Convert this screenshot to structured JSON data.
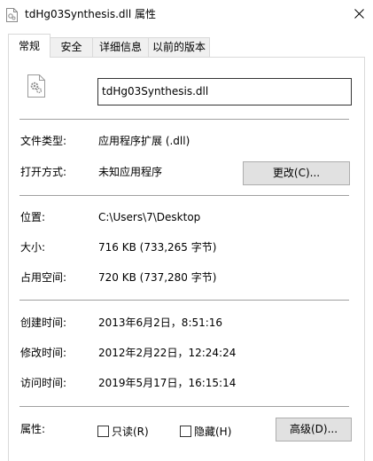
{
  "window": {
    "title": "tdHg03Synthesis.dll 属性"
  },
  "tabs": [
    {
      "label": "常规",
      "active": true
    },
    {
      "label": "安全",
      "active": false
    },
    {
      "label": "详细信息",
      "active": false
    },
    {
      "label": "以前的版本",
      "active": false
    }
  ],
  "general": {
    "file_name": "tdHg03Synthesis.dll",
    "type_label": "文件类型:",
    "type_value": "应用程序扩展 (.dll)",
    "opens_with_label": "打开方式:",
    "opens_with_value": "未知应用程序",
    "change_button": "更改(C)...",
    "location_label": "位置:",
    "location_value": "C:\\Users\\7\\Desktop",
    "size_label": "大小:",
    "size_value": "716 KB (733,265 字节)",
    "size_on_disk_label": "占用空间:",
    "size_on_disk_value": "720 KB (737,280 字节)",
    "created_label": "创建时间:",
    "created_value": "2013年6月2日，8:51:16",
    "modified_label": "修改时间:",
    "modified_value": "2012年2月22日，12:24:24",
    "accessed_label": "访问时间:",
    "accessed_value": "2019年5月17日，16:15:14",
    "attributes_label": "属性:",
    "readonly_label": "只读(R)",
    "readonly_checked": false,
    "hidden_label": "隐藏(H)",
    "hidden_checked": false,
    "advanced_button": "高级(D)..."
  },
  "icons": {
    "title": "dll-file-icon",
    "close": "close-icon",
    "file": "dll-file-icon"
  }
}
